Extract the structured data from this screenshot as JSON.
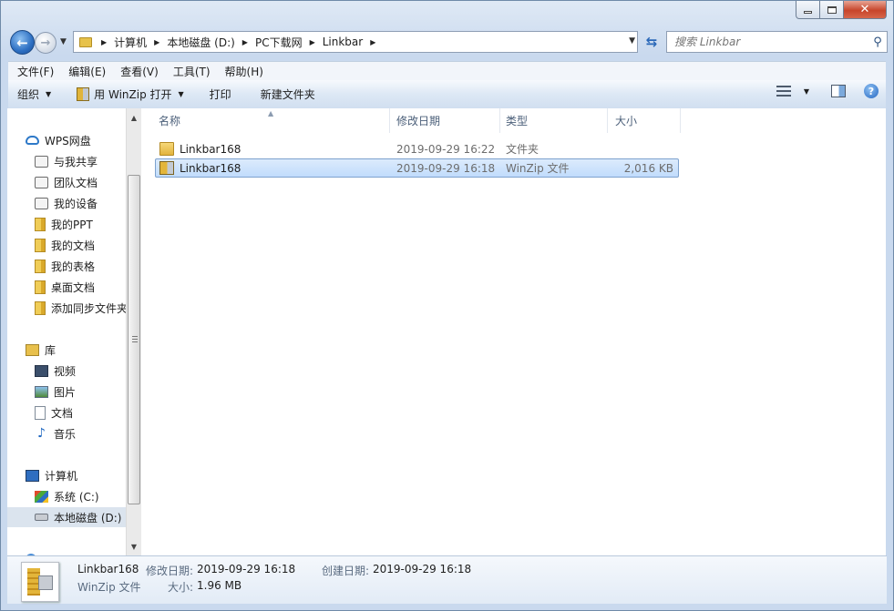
{
  "window": {
    "minimize_glyph": "",
    "close_glyph": "✕"
  },
  "nav": {
    "back_glyph": "←",
    "forward_glyph": "→",
    "breadcrumbs": [
      "计算机",
      "本地磁盘 (D:)",
      "PC下载网",
      "Linkbar"
    ],
    "search_placeholder": "搜索 Linkbar"
  },
  "menubar": {
    "items": [
      "文件(F)",
      "编辑(E)",
      "查看(V)",
      "工具(T)",
      "帮助(H)"
    ]
  },
  "toolbar": {
    "organize": "组织",
    "open_with": "用 WinZip 打开",
    "print": "打印",
    "new_folder": "新建文件夹",
    "help": "?"
  },
  "sidebar": {
    "items": [
      {
        "label": "WPS网盘",
        "icon": "cloud-icon"
      },
      {
        "label": "与我共享",
        "icon": "share-icon"
      },
      {
        "label": "团队文档",
        "icon": "team-icon"
      },
      {
        "label": "我的设备",
        "icon": "device-icon"
      },
      {
        "label": "我的PPT",
        "icon": "folder-icon"
      },
      {
        "label": "我的文档",
        "icon": "folder-icon"
      },
      {
        "label": "我的表格",
        "icon": "folder-icon"
      },
      {
        "label": "桌面文档",
        "icon": "folder-icon"
      },
      {
        "label": "添加同步文件夹",
        "icon": "folder-icon"
      },
      {
        "label": "库",
        "icon": "library-icon"
      },
      {
        "label": "视频",
        "icon": "video-icon"
      },
      {
        "label": "图片",
        "icon": "picture-icon"
      },
      {
        "label": "文档",
        "icon": "document-icon"
      },
      {
        "label": "音乐",
        "icon": "music-icon"
      },
      {
        "label": "计算机",
        "icon": "computer-icon"
      },
      {
        "label": "系统 (C:)",
        "icon": "c-drive-icon"
      },
      {
        "label": "本地磁盘 (D:)",
        "icon": "d-drive-icon"
      }
    ]
  },
  "columns": {
    "name": "名称",
    "modified": "修改日期",
    "type": "类型",
    "size": "大小"
  },
  "files": [
    {
      "name": "Linkbar168",
      "modified": "2019-09-29 16:22",
      "type": "文件夹",
      "size": "",
      "icon": "folder-icon"
    },
    {
      "name": "Linkbar168",
      "modified": "2019-09-29 16:18",
      "type": "WinZip 文件",
      "size": "2,016 KB",
      "icon": "winzip-file-icon"
    }
  ],
  "details": {
    "name": "Linkbar168",
    "type": "WinZip 文件",
    "modified_label": "修改日期:",
    "modified_value": "2019-09-29 16:18",
    "created_label": "创建日期:",
    "created_value": "2019-09-29 16:18",
    "size_label": "大小:",
    "size_value": "1.96 MB"
  },
  "colors": {
    "selection": "#c1dcfc",
    "accent": "#2a68b8"
  }
}
